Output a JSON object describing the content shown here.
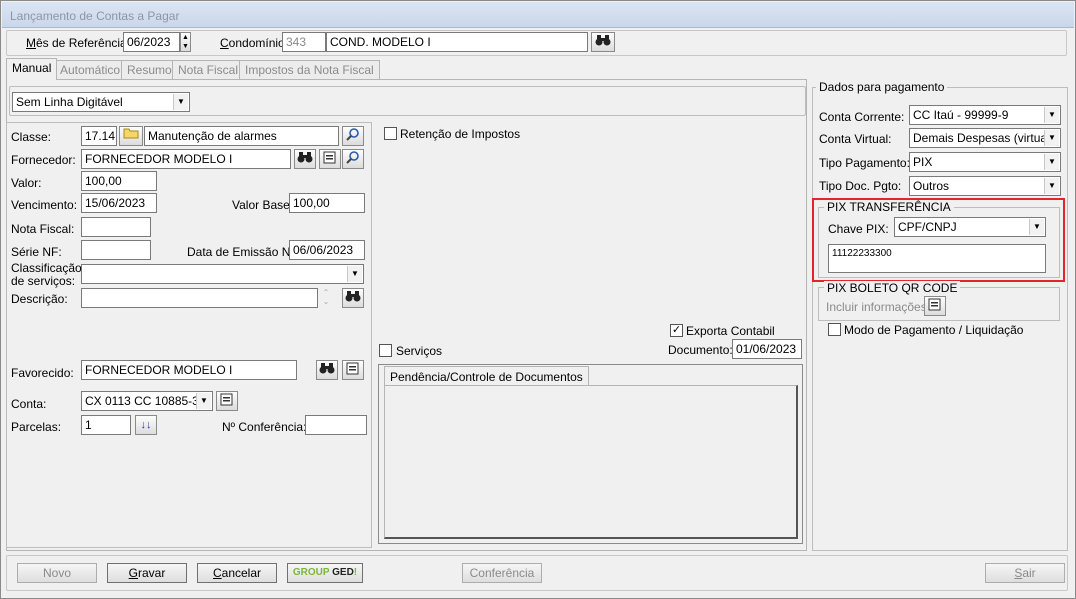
{
  "window": {
    "title": "Lançamento de Contas a Pagar"
  },
  "header": {
    "mes_label": "Mês de Referência:",
    "mes_value": "06/2023",
    "condominio_label": "Condomínio:",
    "condominio_code": "343",
    "condominio_name": "COND. MODELO I"
  },
  "tabs": [
    "Manual",
    "Automático",
    "Resumo",
    "Nota Fiscal",
    "Impostos da Nota Fiscal"
  ],
  "linha_digitavel": {
    "value": "Sem Linha Digitável"
  },
  "form": {
    "classe_label": "Classe:",
    "classe_code": "17.14",
    "classe_desc": "Manutenção de alarmes",
    "fornecedor_label": "Fornecedor:",
    "fornecedor_value": "FORNECEDOR MODELO I",
    "valor_label": "Valor:",
    "valor_value": "100,00",
    "vencimento_label": "Vencimento:",
    "vencimento_value": "15/06/2023",
    "valor_base_label": "Valor Base:",
    "valor_base_value": "100,00",
    "nota_fiscal_label": "Nota Fiscal:",
    "nota_fiscal_value": "",
    "serie_nf_label": "Série NF:",
    "serie_nf_value": "",
    "data_emissao_label": "Data de Emissão NF:",
    "data_emissao_value": "06/06/2023",
    "classificacao_label_1": "Classificação",
    "classificacao_label_2": "de serviços:",
    "classificacao_value": "",
    "descricao_label": "Descrição:",
    "descricao_value": "",
    "favorecido_label": "Favorecido:",
    "favorecido_value": "FORNECEDOR MODELO I",
    "conta_label": "Conta:",
    "conta_value": "CX 0113 CC 10885-3",
    "parcelas_label": "Parcelas:",
    "parcelas_value": "1",
    "conferencia_label": "Nº Conferência:",
    "conferencia_value": "",
    "retencao_label": "Retenção de Impostos",
    "exporta_label": "Exporta Contabil",
    "exporta_checked": true,
    "documento_label": "Documento:",
    "documento_value": "01/06/2023",
    "servicos_label": "Serviços",
    "pendencia_tab": "Pendência/Controle de Documentos"
  },
  "pagamento": {
    "title": "Dados para pagamento",
    "conta_corrente_label": "Conta Corrente:",
    "conta_corrente_value": "CC Itaú - 99999-9",
    "conta_virtual_label": "Conta Virtual:",
    "conta_virtual_value": "Demais Despesas (virtual)",
    "tipo_pagamento_label": "Tipo Pagamento:",
    "tipo_pagamento_value": "PIX",
    "tipo_doc_label": "Tipo Doc. Pgto:",
    "tipo_doc_value": "Outros",
    "pix_title": "PIX TRANSFERÊNCIA",
    "chave_pix_label": "Chave PIX:",
    "chave_pix_type": "CPF/CNPJ",
    "chave_pix_value": "11122233300",
    "boleto_title": "PIX BOLETO QR CODE",
    "incluir_label": "Incluir informações:",
    "modo_label": "Modo de Pagamento / Liquidação",
    "highlight_color": "#e0262b"
  },
  "footer": {
    "novo": "Novo",
    "gravar": "Gravar",
    "cancelar": "Cancelar",
    "group_ged_1": "GROUP",
    "group_ged_2": "GED",
    "conferencia": "Conferência",
    "sair": "Sair"
  }
}
